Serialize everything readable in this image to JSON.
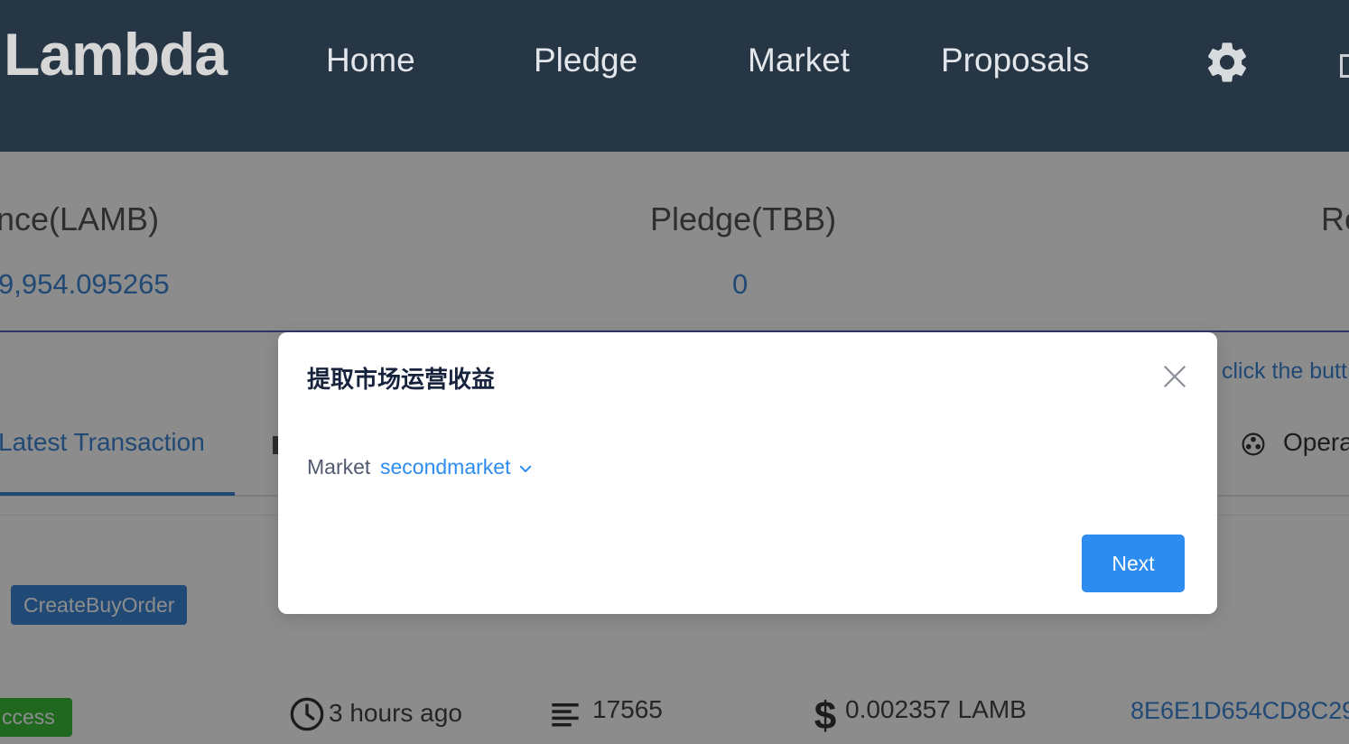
{
  "header": {
    "logo": "Lambda",
    "nav": [
      "Home",
      "Pledge",
      "Market",
      "Proposals"
    ],
    "settings_icon": "gear-icon"
  },
  "stats": {
    "balance_label": "nce(LAMB)",
    "balance_value": "9,954.095265",
    "pledge_label": "Pledge(TBB)",
    "pledge_value": "0",
    "third_label": "Re"
  },
  "hint": "click the butt",
  "tabs": {
    "latest": "Latest Transaction",
    "operation": "Opera"
  },
  "transaction": {
    "type": "CreateBuyOrder",
    "status": "ccess",
    "time": "3 hours ago",
    "height": "17565",
    "fee": "0.002357 LAMB",
    "hash": "8E6E1D654CD8C29"
  },
  "modal": {
    "title": "提取市场运营收益",
    "market_label": "Market",
    "market_value": "secondmarket",
    "next_label": "Next"
  },
  "colors": {
    "header_bg": "#263645",
    "accent": "#2d8cf0",
    "link": "#3d86d6",
    "success": "#3bbd3b"
  }
}
